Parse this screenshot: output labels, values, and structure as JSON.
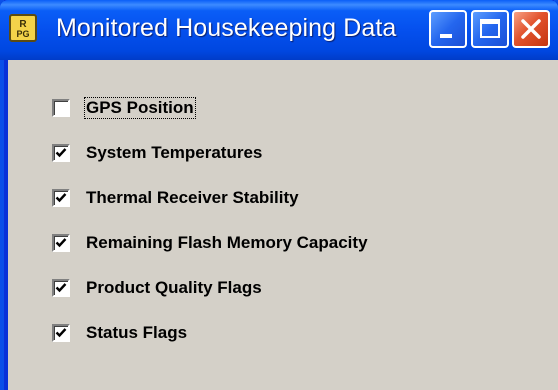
{
  "window": {
    "title": "Monitored Housekeeping Data",
    "app_icon": "rpg-logo-icon",
    "controls": {
      "minimize": "minimize-icon",
      "maximize": "maximize-icon",
      "close": "close-icon"
    }
  },
  "options": [
    {
      "label": "GPS Position",
      "checked": false,
      "focused": true
    },
    {
      "label": "System Temperatures",
      "checked": true,
      "focused": false
    },
    {
      "label": "Thermal Receiver Stability",
      "checked": true,
      "focused": false
    },
    {
      "label": "Remaining Flash Memory Capacity",
      "checked": true,
      "focused": false
    },
    {
      "label": "Product Quality Flags",
      "checked": true,
      "focused": false
    },
    {
      "label": "Status Flags",
      "checked": true,
      "focused": false
    }
  ],
  "colors": {
    "titlebar": "#0550ee",
    "client_background": "#d4d0c8",
    "close_button": "#e2532d"
  }
}
